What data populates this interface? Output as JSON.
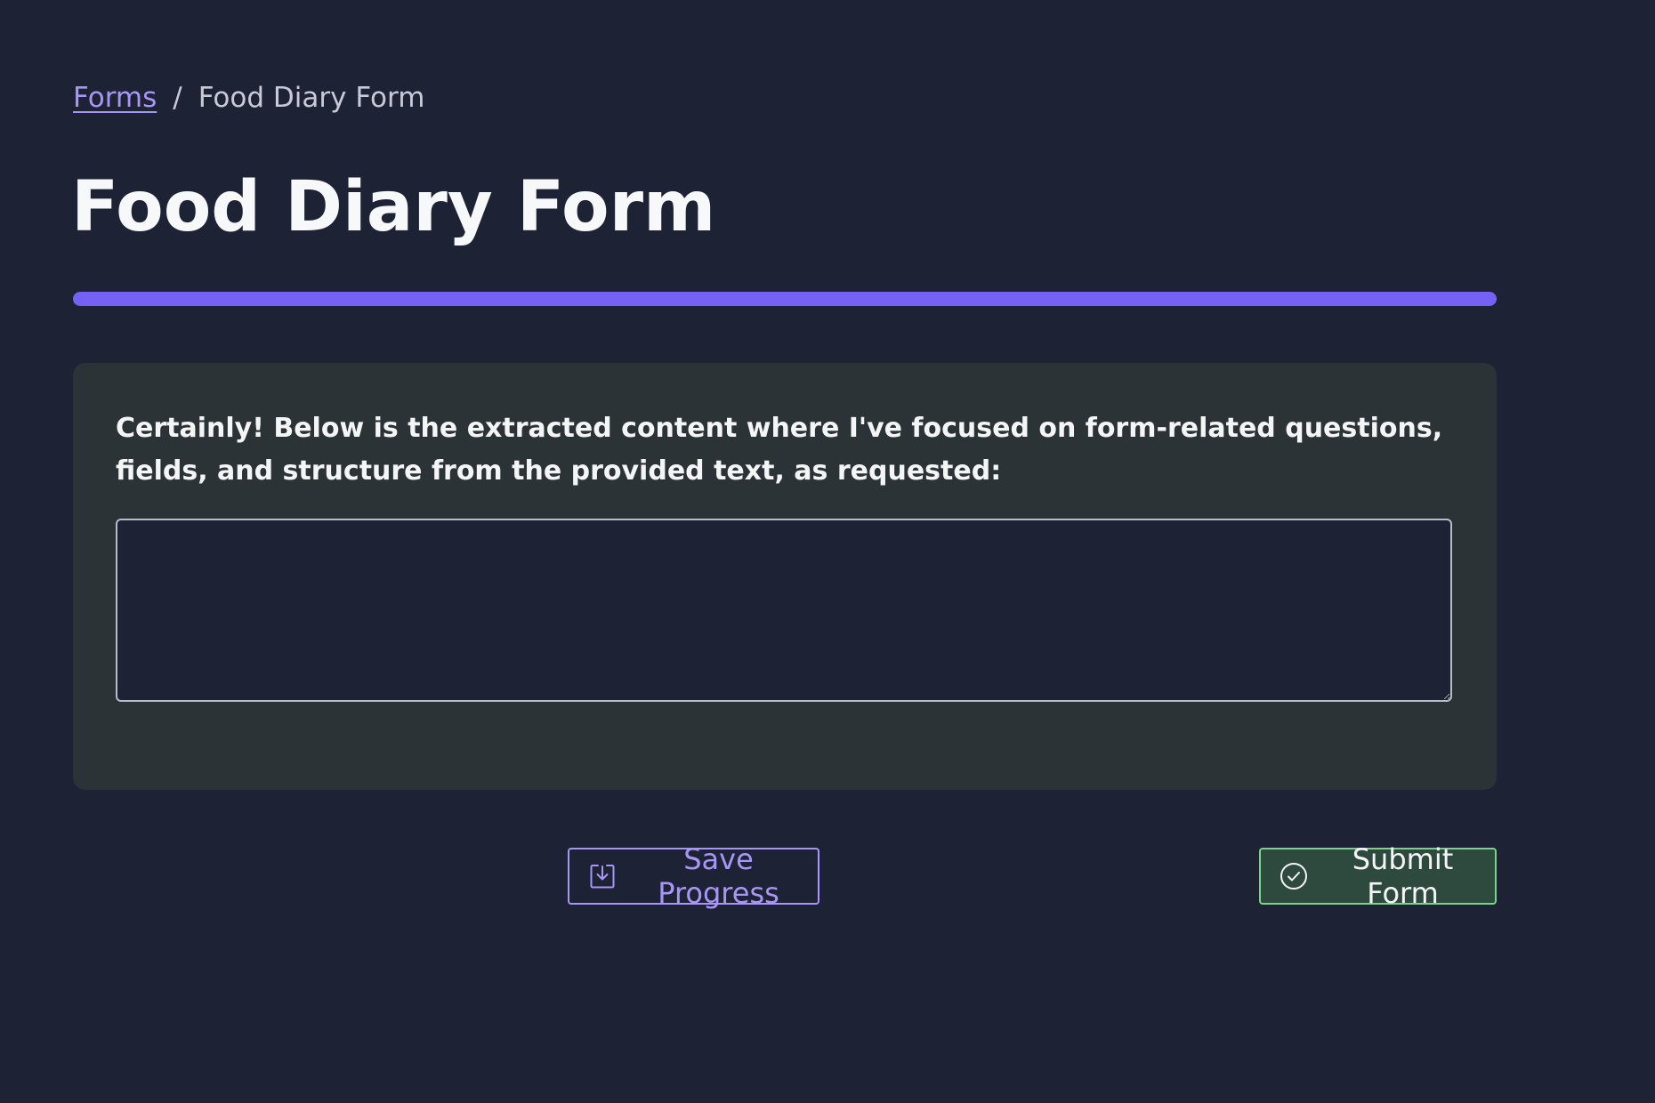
{
  "breadcrumb": {
    "root_label": "Forms",
    "separator": "/",
    "current_label": "Food Diary Form"
  },
  "header": {
    "title": "Food Diary Form"
  },
  "colors": {
    "background": "#1e2235",
    "accent": "#7561f4",
    "link": "#a796f5",
    "card": "#2c3337",
    "success_border": "#7fd08b",
    "success_background": "#2e4a3e"
  },
  "form": {
    "question_label": "Certainly! Below is the extracted content where I've focused on form-related questions, fields, and structure from the provided text, as requested:",
    "answer_value": "",
    "answer_placeholder": ""
  },
  "actions": {
    "save_label": "Save Progress",
    "save_icon": "save-download-icon",
    "submit_label": "Submit Form",
    "submit_icon": "check-circle-icon"
  }
}
